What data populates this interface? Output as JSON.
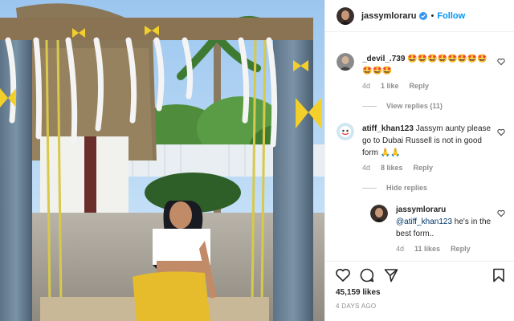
{
  "post": {
    "username": "jassymloraru",
    "follow_label": "Follow",
    "dot": "•",
    "likes": "45,159 likes",
    "time_ago": "4 DAYS AGO"
  },
  "comments": [
    {
      "username": "_devil_.739",
      "text": "🤩🤩🤩🤩🤩🤩🤩🤩🤩🤩🤩",
      "time": "4d",
      "likes": "1 like",
      "reply_label": "Reply",
      "view_replies": "View replies (11)"
    },
    {
      "username": "atiff_khan123",
      "text": "Jassym aunty please go to Dubai Russell is not in good form 🙏🙏",
      "time": "4d",
      "likes": "8 likes",
      "reply_label": "Reply",
      "view_replies": "Hide replies"
    },
    {
      "username": "jassymloraru",
      "mention": "@atiff_khan123",
      "text": " he's in the best form..",
      "time": "4d",
      "likes": "11 likes",
      "reply_label": "Reply"
    }
  ],
  "icons": {
    "like": "heart-icon",
    "comment": "comment-icon",
    "share": "share-icon",
    "save": "bookmark-icon",
    "verified": "verified-badge-icon",
    "comment_like": "heart-outline-icon"
  },
  "colors": {
    "follow": "#0095f6",
    "meta": "#8e8e8e",
    "text": "#262626",
    "verified": "#3897f0"
  }
}
